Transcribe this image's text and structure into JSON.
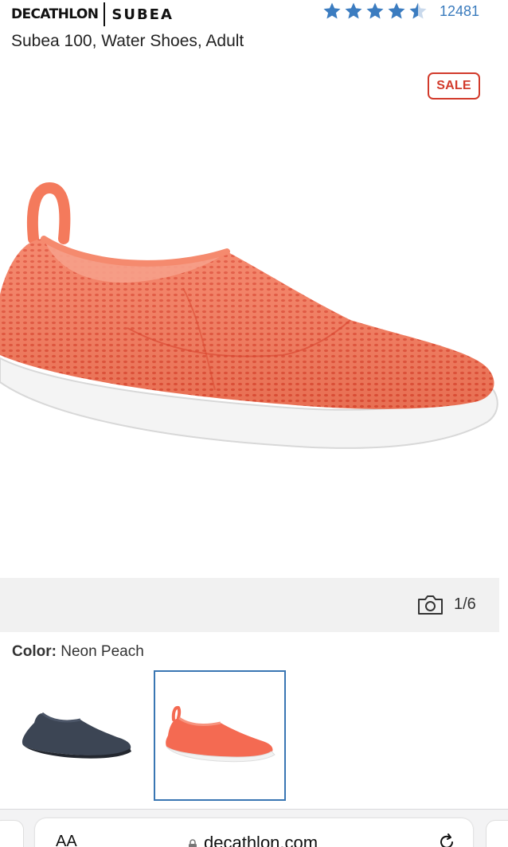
{
  "header": {
    "brand_primary": "DECATHLON",
    "brand_secondary": "SUBEA",
    "rating": {
      "stars": 4.5,
      "count": "12481",
      "star_color": "#3b7cc0"
    },
    "product_title": "Subea 100, Water Shoes, Adult"
  },
  "badge": {
    "label": "SALE",
    "color": "#d23a2b"
  },
  "gallery": {
    "counter": "1/6",
    "icon": "camera-icon"
  },
  "color_selector": {
    "label": "Color:",
    "value": "Neon Peach",
    "swatches": [
      {
        "name": "navy",
        "selected": false,
        "color": "#3c4554"
      },
      {
        "name": "neon-peach",
        "selected": true,
        "color": "#f46a52"
      }
    ],
    "selected_border": "#3976b3"
  },
  "browser": {
    "text_size": "AA",
    "url": "decathlon.com",
    "icons": [
      "lock-icon",
      "reload-icon"
    ]
  }
}
